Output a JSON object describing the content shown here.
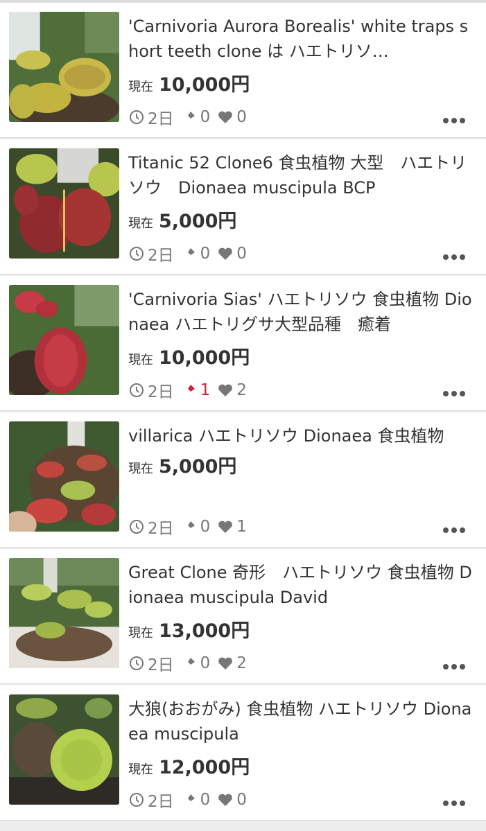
{
  "listings": [
    {
      "title": "'Carnivoria Aurora Borealis' white traps short teeth clone は ハエトリソ…",
      "price_label": "現在",
      "price": "10,000円",
      "time_left": "2日",
      "bids": "0",
      "watchers": "0",
      "bids_active": false
    },
    {
      "title": "Titanic 52 Clone6 食虫植物 大型　ハエトリソウ　Dionaea muscipula BCP",
      "price_label": "現在",
      "price": "5,000円",
      "time_left": "2日",
      "bids": "0",
      "watchers": "0",
      "bids_active": false
    },
    {
      "title": "'Carnivoria Sias' ハエトリソウ 食虫植物 Dionaea ハエトリグサ大型品種　癒着",
      "price_label": "現在",
      "price": "10,000円",
      "time_left": "2日",
      "bids": "1",
      "watchers": "2",
      "bids_active": true
    },
    {
      "title": "villarica ハエトリソウ Dionaea 食虫植物",
      "price_label": "現在",
      "price": "5,000円",
      "time_left": "2日",
      "bids": "0",
      "watchers": "1",
      "bids_active": false
    },
    {
      "title": "Great Clone 奇形　ハエトリソウ 食虫植物 Dionaea muscipula David",
      "price_label": "現在",
      "price": "13,000円",
      "time_left": "2日",
      "bids": "0",
      "watchers": "2",
      "bids_active": false
    },
    {
      "title": "大狼(おおがみ) 食虫植物 ハエトリソウ Dionaea muscipula",
      "price_label": "現在",
      "price": "12,000円",
      "time_left": "2日",
      "bids": "0",
      "watchers": "0",
      "bids_active": false
    }
  ],
  "icons": {
    "time": "clock-icon",
    "bids": "gavel-icon",
    "watchers": "heart-icon",
    "more": "more-dots-icon"
  },
  "colors": {
    "text": "#333333",
    "meta": "#777777",
    "bid_active": "#d81b3c",
    "background": "#ededed"
  }
}
